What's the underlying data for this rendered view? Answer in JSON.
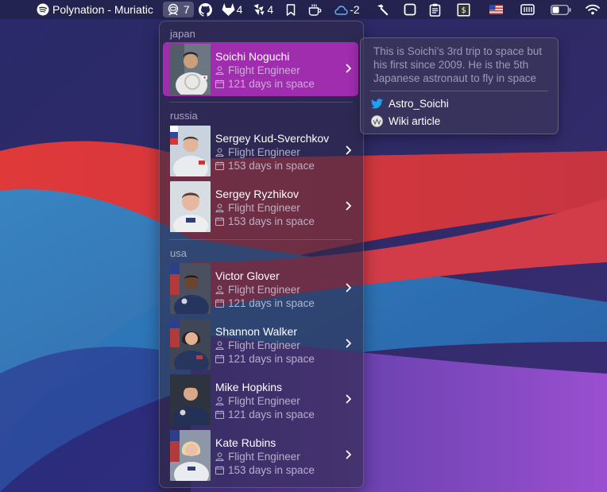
{
  "menubar": {
    "spotify_text": "Polynation - Muriatic",
    "astro_count": "7",
    "gitlab_count": "4",
    "merge_count": "4",
    "weather_count": "-2",
    "icons": [
      "apple-icon",
      "spotify-icon",
      "astronaut-icon",
      "github-icon",
      "gitlab-icon",
      "merge-request-icon",
      "bookmark-icon",
      "coffee-icon",
      "weather-icon",
      "hammer-icon",
      "window-icon",
      "clipboard-icon",
      "terminal-icon",
      "us-flag-icon",
      "keyboard-icon",
      "battery-icon",
      "wifi-icon"
    ]
  },
  "menu": {
    "sections": [
      {
        "label": "japan",
        "astronauts": [
          {
            "name": "Soichi Noguchi",
            "role": "Flight Engineer",
            "days": "121 days in space"
          }
        ]
      },
      {
        "label": "russia",
        "astronauts": [
          {
            "name": "Sergey Kud-Sverchkov",
            "role": "Flight Engineer",
            "days": "153 days in space"
          },
          {
            "name": "Sergey Ryzhikov",
            "role": "Flight Engineer",
            "days": "153 days in space"
          }
        ]
      },
      {
        "label": "usa",
        "astronauts": [
          {
            "name": "Victor Glover",
            "role": "Flight Engineer",
            "days": "121 days in space"
          },
          {
            "name": "Shannon Walker",
            "role": "Flight Engineer",
            "days": "121 days in space"
          },
          {
            "name": "Mike Hopkins",
            "role": "Flight Engineer",
            "days": "121 days in space"
          },
          {
            "name": "Kate Rubins",
            "role": "Flight Engineer",
            "days": "153 days in space"
          }
        ]
      }
    ]
  },
  "tooltip": {
    "text": "This is Soichi’s 3rd trip to space but his first since 2009. He is the 5th Japanese astronaut to fly in space",
    "twitter": "Astro_Soichi",
    "wiki": "Wiki article"
  },
  "colors": {
    "selected": "#a02cae",
    "twitter": "#1da1f2"
  }
}
